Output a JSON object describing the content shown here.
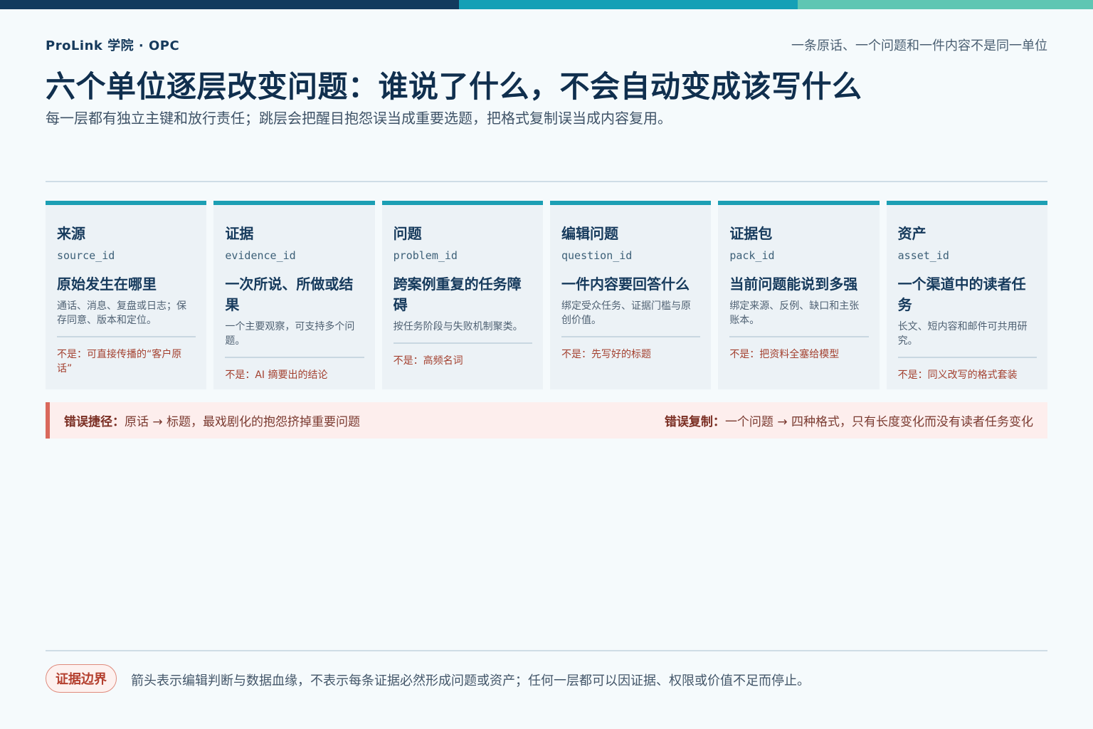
{
  "header": {
    "brand": "ProLink 学院 · OPC",
    "tagline": "一条原话、一个问题和一件内容不是同一单位",
    "title": "六个单位逐层改变问题：谁说了什么，不会自动变成该写什么",
    "subtitle": "每一层都有独立主键和放行责任；跳层会把醒目抱怨误当成重要选题，把格式复制误当成内容复用。"
  },
  "cards": [
    {
      "name": "来源",
      "key": "source_id",
      "headline": "原始发生在哪里",
      "desc": "通话、消息、复盘或日志；保存同意、版本和定位。",
      "not": "不是：可直接传播的“客户原话”"
    },
    {
      "name": "证据",
      "key": "evidence_id",
      "headline": "一次所说、所做或结果",
      "desc": "一个主要观察，可支持多个问题。",
      "not": "不是：AI 摘要出的结论"
    },
    {
      "name": "问题",
      "key": "problem_id",
      "headline": "跨案例重复的任务障碍",
      "desc": "按任务阶段与失败机制聚类。",
      "not": "不是：高频名词"
    },
    {
      "name": "编辑问题",
      "key": "question_id",
      "headline": "一件内容要回答什么",
      "desc": "绑定受众任务、证据门槛与原创价值。",
      "not": "不是：先写好的标题"
    },
    {
      "name": "证据包",
      "key": "pack_id",
      "headline": "当前问题能说到多强",
      "desc": "绑定来源、反例、缺口和主张账本。",
      "not": "不是：把资料全塞给模型"
    },
    {
      "name": "资产",
      "key": "asset_id",
      "headline": "一个渠道中的读者任务",
      "desc": "长文、短内容和邮件可共用研究。",
      "not": "不是：同义改写的格式套装"
    }
  ],
  "warnings": {
    "left_label": "错误捷径：",
    "left_text": "原话 → 标题，最戏剧化的抱怨挤掉重要问题",
    "right_label": "错误复制：",
    "right_text": "一个问题 → 四种格式，只有长度变化而没有读者任务变化"
  },
  "footer": {
    "badge": "证据边界",
    "note": "箭头表示编辑判断与数据血缘，不表示每条证据必然形成问题或资产；任何一层都可以因证据、权限或价值不足而停止。"
  },
  "colors": {
    "background": "#f5fafc",
    "navy": "#123a5e",
    "teal": "#14a0b6",
    "mint": "#5fc6b3",
    "warning": "#d9695c"
  }
}
